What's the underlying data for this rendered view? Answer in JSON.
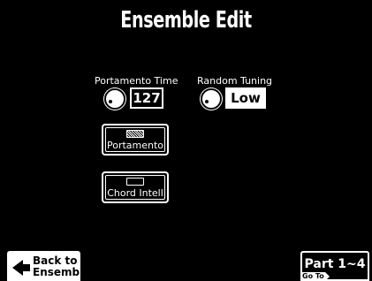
{
  "screen": {
    "title": "Ensemble Edit"
  },
  "params": {
    "portamento_time": {
      "label": "Portamento Time",
      "value": "127"
    },
    "random_tuning": {
      "label": "Random Tuning",
      "value": "Low"
    }
  },
  "buttons": {
    "portamento": {
      "label": "Portamento",
      "lamp": "on"
    },
    "chord_intell": {
      "label": "Chord Intell",
      "lamp": "off"
    }
  },
  "nav": {
    "back_label_line1": "Back to",
    "back_label_line2": "Ensembl",
    "part_label": "Part 1~4",
    "goto_label": "Go To"
  },
  "colors": {
    "background": "#000000",
    "foreground": "#ffffff"
  },
  "icons": [
    "knob-icon",
    "back-arrow-icon",
    "lamp-indicator-icon"
  ]
}
